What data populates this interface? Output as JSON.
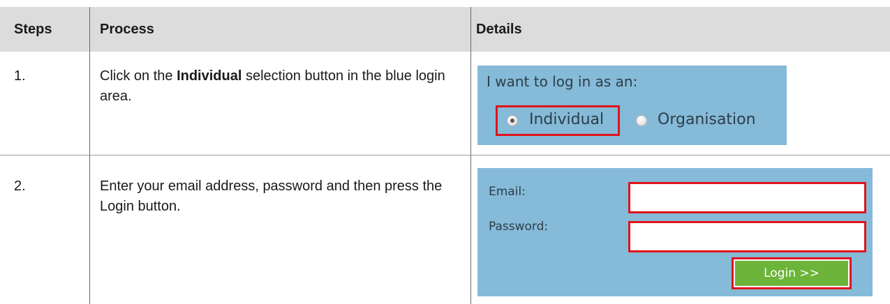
{
  "table": {
    "headers": {
      "steps": "Steps",
      "process": "Process",
      "details": "Details"
    },
    "rows": [
      {
        "step": "1.",
        "process_pre": "Click on the ",
        "process_bold": "Individual",
        "process_post": " selection button in the blue login area."
      },
      {
        "step": "2.",
        "process_text": "Enter your email address, password and then press the Login button."
      }
    ]
  },
  "panel1": {
    "title": "I want to log in as an:",
    "options": [
      {
        "label": "Individual",
        "selected": true
      },
      {
        "label": "Organisation",
        "selected": false
      }
    ]
  },
  "panel2": {
    "email_label": "Email:",
    "email_value": "",
    "password_label": "Password:",
    "password_value": "",
    "login_label": "Login >>"
  },
  "colors": {
    "header_band": "#dcdcdc",
    "panel_blue": "#85bad8",
    "highlight_red": "#e0141b",
    "login_green": "#6db43a"
  }
}
